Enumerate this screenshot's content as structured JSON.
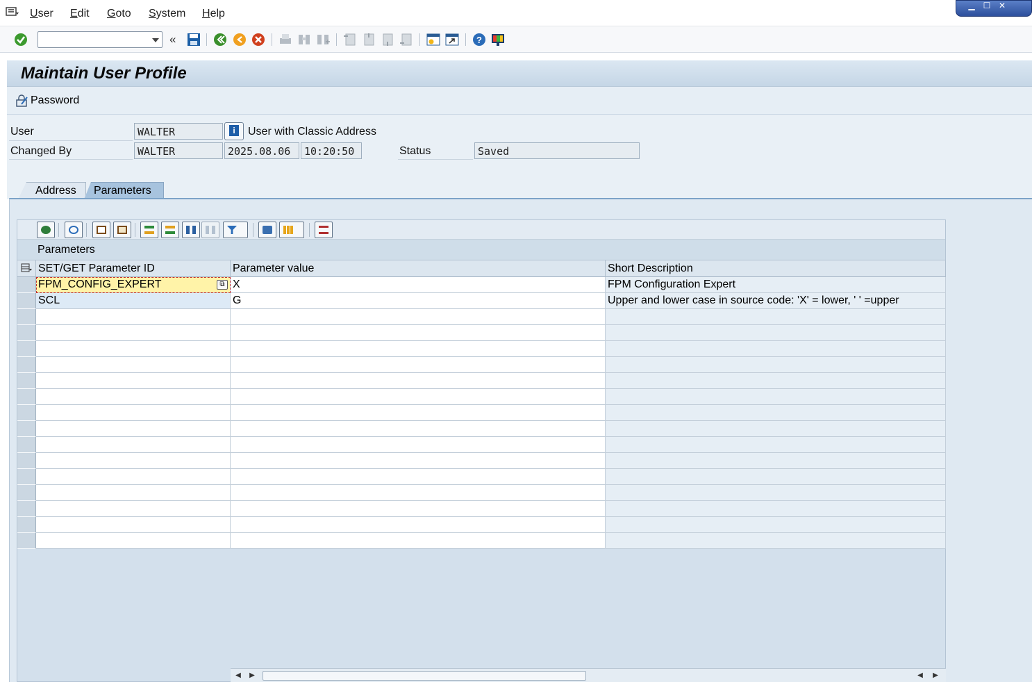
{
  "menu": {
    "items": [
      {
        "label": "User",
        "mnemonic": "U",
        "rest": "ser"
      },
      {
        "label": "Edit",
        "mnemonic": "E",
        "rest": "dit"
      },
      {
        "label": "Goto",
        "mnemonic": "G",
        "rest": "oto"
      },
      {
        "label": "System",
        "mnemonic": "S",
        "rest": "ystem"
      },
      {
        "label": "Help",
        "mnemonic": "H",
        "rest": "elp"
      }
    ]
  },
  "toolbar": {
    "command_value": "",
    "icons": [
      "enter-icon",
      "save-icon",
      "back-icon",
      "exit-icon",
      "cancel-icon",
      "print-icon",
      "find-icon",
      "find-next-icon",
      "first-page-icon",
      "previous-page-icon",
      "next-page-icon",
      "last-page-icon",
      "create-session-icon",
      "shortcut-icon",
      "help-icon",
      "customize-layout-icon"
    ]
  },
  "title": "Maintain User Profile",
  "appbar": {
    "password_label": "Password"
  },
  "header": {
    "user_label": "User",
    "user_value": "WALTER",
    "user_type": "User with Classic Address",
    "changed_by_label": "Changed By",
    "changed_by_value": "WALTER",
    "changed_date": "2025.08.06",
    "changed_time": "10:20:50",
    "status_label": "Status",
    "status_value": "Saved"
  },
  "tabs": [
    {
      "label": "Address",
      "active": false
    },
    {
      "label": "Parameters",
      "active": true
    }
  ],
  "grid": {
    "title": "Parameters",
    "columns": [
      "SET/GET Parameter ID",
      "Parameter value",
      "Short Description"
    ],
    "rows": [
      {
        "id": "FPM_CONFIG_EXPERT",
        "value": "X",
        "description": "FPM Configuration Expert"
      },
      {
        "id": "SCL",
        "value": "G",
        "description": "Upper and lower case in source code: 'X' = lower, ' ' =upper"
      }
    ],
    "empty_rows": 15,
    "accent": "#a7c3de"
  }
}
